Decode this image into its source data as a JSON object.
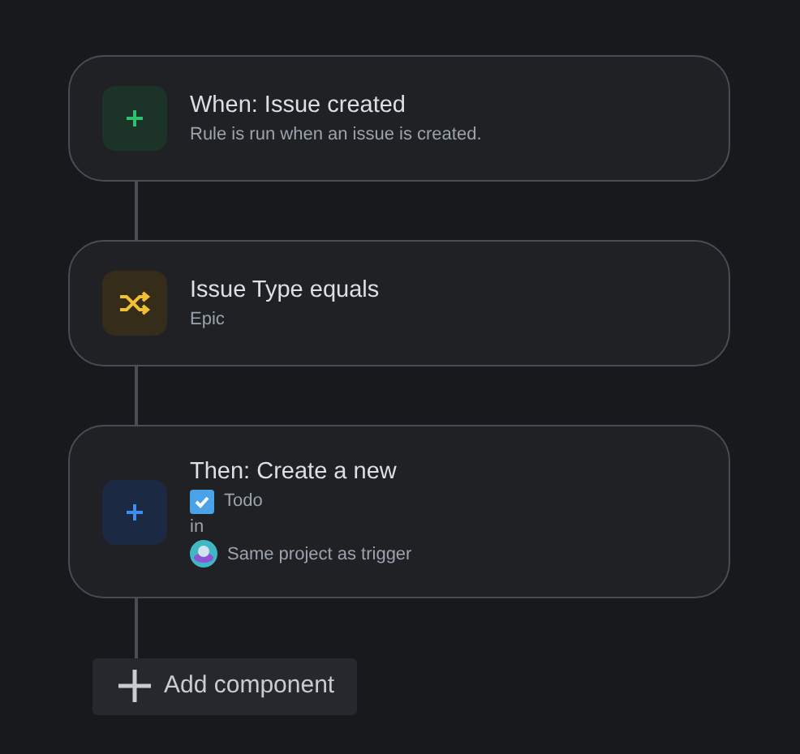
{
  "steps": [
    {
      "kind": "trigger",
      "title": "When: Issue created",
      "details": [
        {
          "kind": "text",
          "text": "Rule is run when an issue is created."
        }
      ]
    },
    {
      "kind": "condition",
      "title": "Issue Type equals",
      "details": [
        {
          "kind": "text",
          "text": "Epic"
        }
      ]
    },
    {
      "kind": "action",
      "title": "Then: Create a new",
      "details": [
        {
          "kind": "issue-type",
          "text": "Todo"
        },
        {
          "kind": "plain",
          "text": "in"
        },
        {
          "kind": "project",
          "text": "Same project as trigger"
        }
      ]
    }
  ],
  "add_button": {
    "label": "Add component"
  }
}
